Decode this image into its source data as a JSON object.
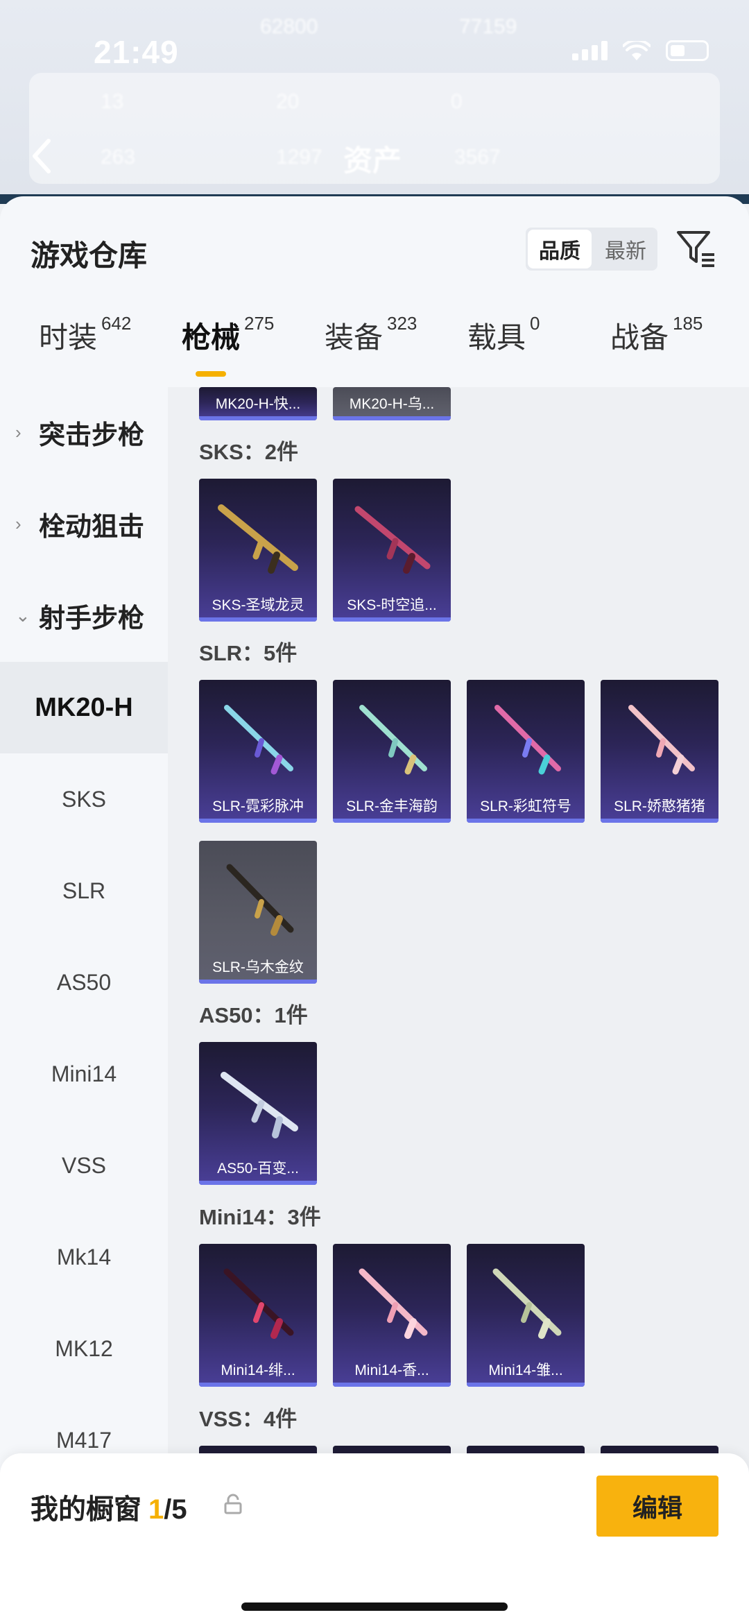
{
  "status": {
    "time": "21:49"
  },
  "header": {
    "title": "资产",
    "blurred_stats": [
      "62800",
      "77159",
      "13",
      "20",
      "0",
      "263",
      "1297",
      "3567"
    ]
  },
  "sheet": {
    "title": "游戏仓库",
    "sort_options": [
      "品质",
      "最新"
    ],
    "active_sort": "品质"
  },
  "tabs": [
    {
      "label": "时装",
      "count": "642"
    },
    {
      "label": "枪械",
      "count": "275"
    },
    {
      "label": "装备",
      "count": "323"
    },
    {
      "label": "载具",
      "count": "0"
    },
    {
      "label": "战备",
      "count": "185"
    }
  ],
  "sidebar": {
    "categories": [
      {
        "label": "突击步枪",
        "chevron": ">"
      },
      {
        "label": "栓动狙击",
        "chevron": ">"
      },
      {
        "label": "射手步枪",
        "chevron": "v"
      }
    ],
    "items": [
      "MK20-H",
      "SKS",
      "SLR",
      "AS50",
      "Mini14",
      "VSS",
      "Mk14",
      "MK12",
      "M417"
    ],
    "active_item": "MK20-H"
  },
  "content": {
    "stub_cards": [
      "MK20-H-快...",
      "MK20-H-乌..."
    ],
    "groups": [
      {
        "title": "SKS：2件",
        "items": [
          "SKS-圣域龙灵",
          "SKS-时空追..."
        ]
      },
      {
        "title": "SLR：5件",
        "items": [
          "SLR-霓彩脉冲",
          "SLR-金丰海韵",
          "SLR-彩虹符号",
          "SLR-娇憨猪猪",
          "SLR-乌木金纹"
        ]
      },
      {
        "title": "AS50：1件",
        "items": [
          "AS50-百变..."
        ]
      },
      {
        "title": "Mini14：3件",
        "items": [
          "Mini14-绯...",
          "Mini14-香...",
          "Mini14-雏..."
        ]
      },
      {
        "title": "VSS：4件",
        "items": []
      }
    ]
  },
  "bottom": {
    "showcase_label": "我的橱窗",
    "current": "1",
    "total": "/5",
    "edit_label": "编辑"
  },
  "colors": {
    "accent": "#f8b20e",
    "card_bottom": "#6b74e8"
  }
}
